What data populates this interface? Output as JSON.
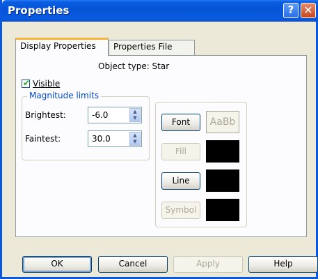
{
  "window": {
    "title": "Properties",
    "help_button": "?",
    "close_button": "✕"
  },
  "tabs": [
    {
      "label": "Display Properties",
      "active": true
    },
    {
      "label": "Properties File",
      "active": false
    }
  ],
  "panel": {
    "object_type": "Object type: Star",
    "visible": {
      "label": "Visible",
      "checked": true,
      "check_glyph": "✔"
    },
    "magnitude_limits": {
      "legend": "Magnitude limits",
      "brightest": {
        "label": "Brightest:",
        "value": "-6.0"
      },
      "faintest": {
        "label": "Faintest:",
        "value": "30.0"
      },
      "spin_up": "▲",
      "spin_down": "▼"
    },
    "style": {
      "font": {
        "label": "Font",
        "sample": "AaBb",
        "enabled": true
      },
      "fill": {
        "label": "Fill",
        "color": "#000000",
        "enabled": false
      },
      "line": {
        "label": "Line",
        "color": "#000000",
        "enabled": true
      },
      "symbol": {
        "label": "Symbol",
        "color": "#000000",
        "enabled": false
      }
    }
  },
  "buttons": {
    "ok": "OK",
    "cancel": "Cancel",
    "apply": "Apply",
    "help": "Help"
  },
  "colors": {
    "titlebar": "#0553d6",
    "dialog_bg": "#ece9d8",
    "tab_accent": "#f7b336",
    "group_legend": "#0046d5"
  }
}
